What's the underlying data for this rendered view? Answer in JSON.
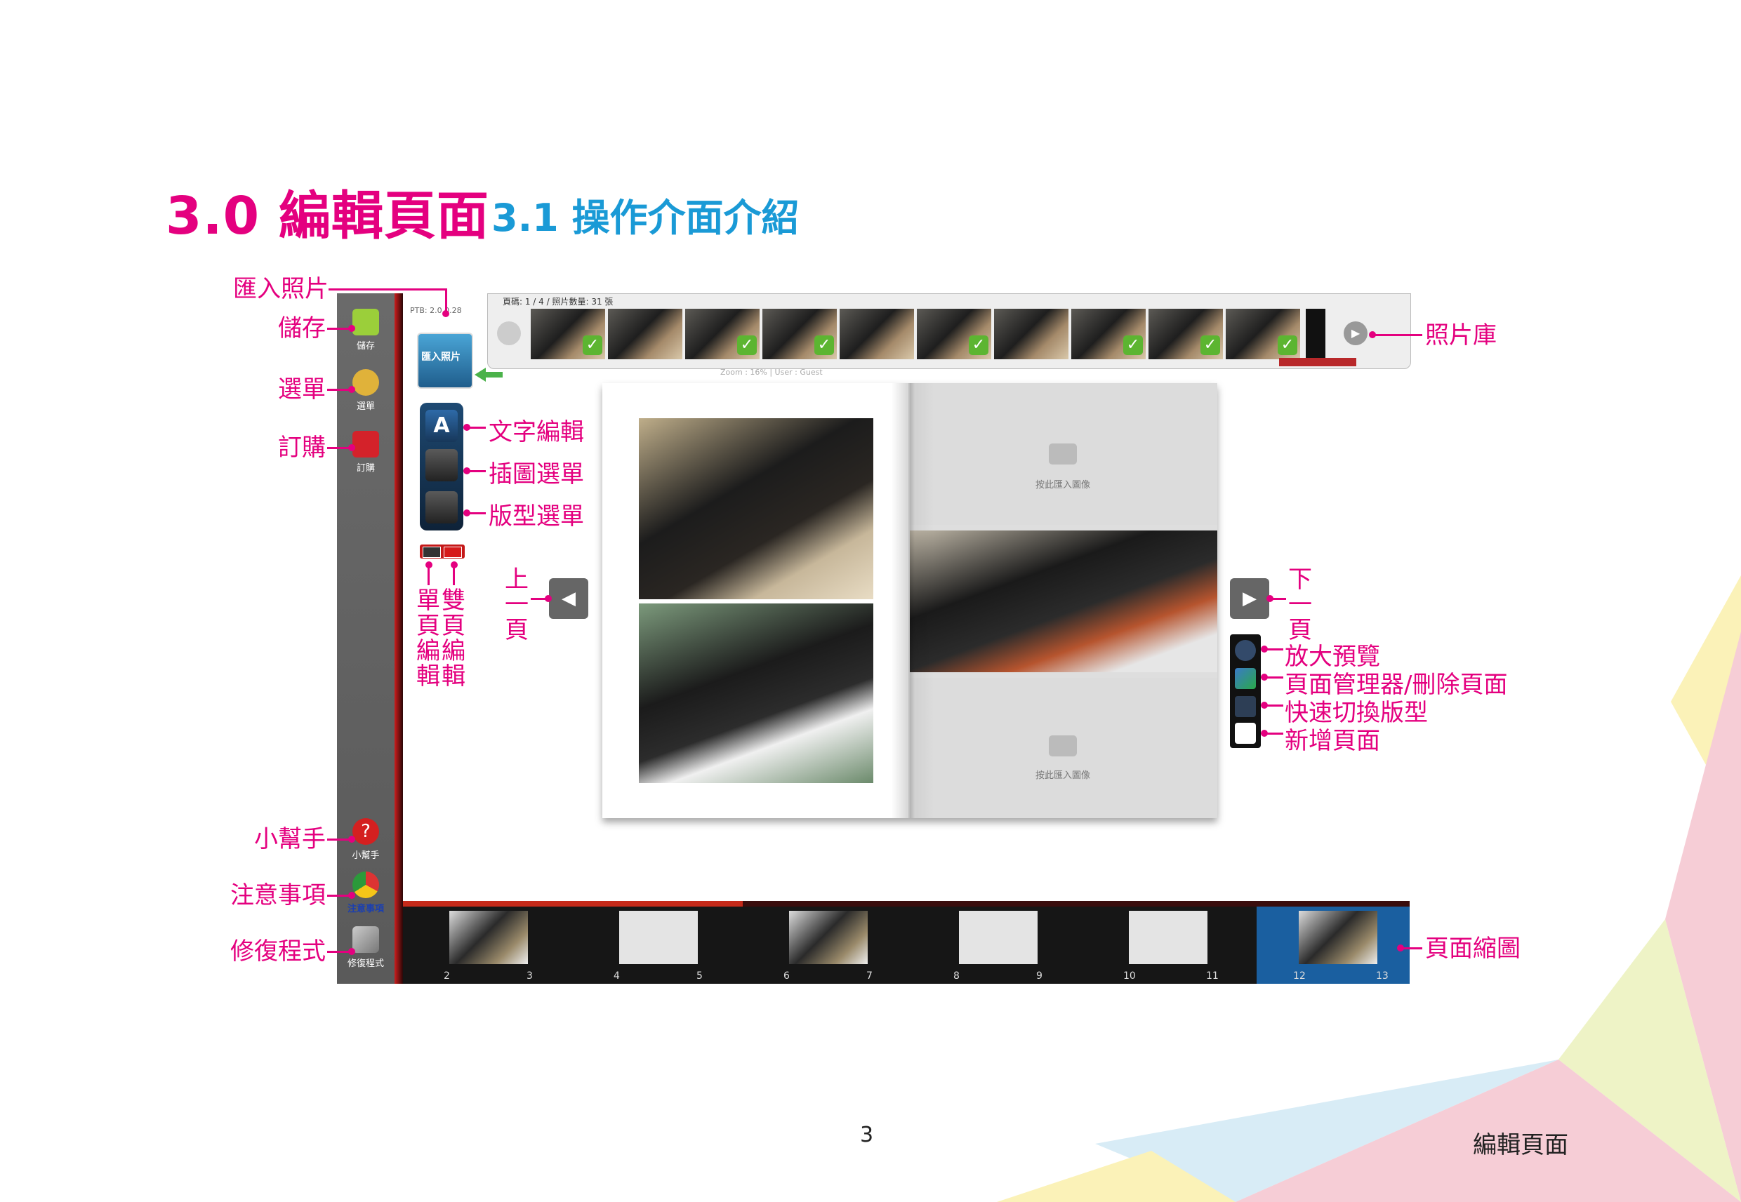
{
  "heading": {
    "main": "3.0 編輯頁面",
    "sub": "3.1 操作介面介紹"
  },
  "page_number": "3",
  "footer_label": "編輯頁面",
  "colors": {
    "accent": "#e4007f",
    "sub_heading": "#1a9ad6",
    "sidebar": "#5f5f5f",
    "selected_spread": "#1a5fa0"
  },
  "sidebar": {
    "save": {
      "label": "儲存",
      "icon": "floppy-icon"
    },
    "menu": {
      "label": "選單",
      "icon": "undo-arrow-icon"
    },
    "order": {
      "label": "訂購",
      "icon": "cart-icon"
    },
    "help": {
      "label": "小幫手",
      "icon": "question-icon"
    },
    "notice": {
      "label": "注意事項",
      "icon": "chrome-icon"
    },
    "repair": {
      "label": "修復程式",
      "icon": "wrench-icon"
    }
  },
  "filmstrip": {
    "title": "頁碼: 1 / 4 / 照片數量: 31 張",
    "meta": "PTB: 2.0.0.28",
    "zoom_text": "Zoom : 16% | User : Guest",
    "thumbs": [
      {
        "checked": true
      },
      {
        "checked": false
      },
      {
        "checked": true
      },
      {
        "checked": true
      },
      {
        "checked": false
      },
      {
        "checked": true
      },
      {
        "checked": false
      },
      {
        "checked": true
      },
      {
        "checked": true
      },
      {
        "checked": true
      }
    ]
  },
  "import_button": {
    "label": "匯入照片"
  },
  "placeholder_text": "按此匯入圖像",
  "spread_numbers": [
    [
      "2",
      "3"
    ],
    [
      "4",
      "5"
    ],
    [
      "6",
      "7"
    ],
    [
      "8",
      "9"
    ],
    [
      "10",
      "11"
    ],
    [
      "12",
      "13"
    ]
  ],
  "annotations": {
    "import_photos": "匯入照片",
    "save": "儲存",
    "menu": "選單",
    "order": "訂購",
    "text_edit": "文字編輯",
    "clipart_menu": "插圖選單",
    "layout_menu": "版型選單",
    "single_page_edit": "單頁編輯",
    "double_page_edit": "雙頁編輯",
    "prev_page": "上一頁",
    "next_page": "下一頁",
    "photo_library": "照片庫",
    "zoom_preview": "放大預覽",
    "page_manager": "頁面管理器/刪除頁面",
    "quick_layout": "快速切換版型",
    "add_page": "新增頁面",
    "help": "小幫手",
    "notice": "注意事項",
    "repair": "修復程式",
    "page_thumbs": "頁面縮圖"
  }
}
